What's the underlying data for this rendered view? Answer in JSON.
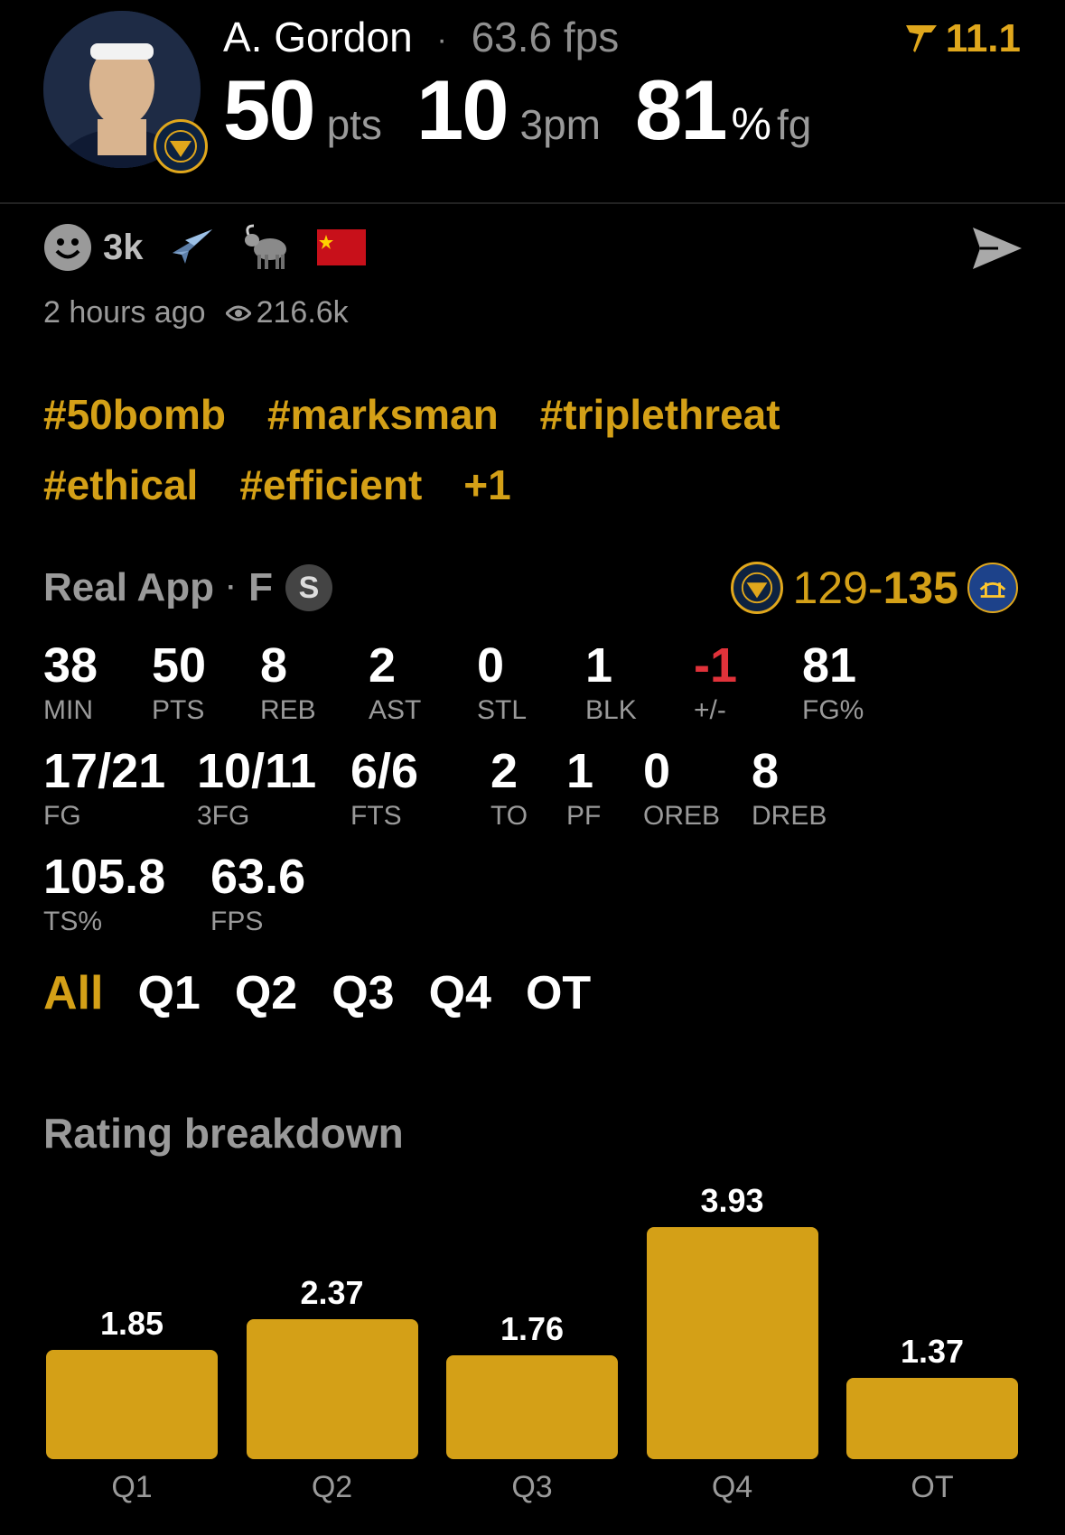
{
  "header": {
    "player_name": "A. Gordon",
    "separator": "·",
    "fps_text": "63.6 fps",
    "headline": [
      {
        "value": "50",
        "unit": "pts"
      },
      {
        "value": "10",
        "unit": "3pm"
      },
      {
        "value": "81",
        "unit": "%",
        "unit2": "fg"
      }
    ],
    "badge_value": "11.1",
    "badge_icon": "real-logo-icon"
  },
  "social": {
    "reaction_icon": "smiley-icon",
    "reaction_count": "3k",
    "emojis": [
      "airplane-icon",
      "goat-icon",
      "china-flag-icon"
    ],
    "share_icon": "send-icon",
    "time_ago": "2 hours ago",
    "views": "216.6k"
  },
  "hashtags": {
    "line1": [
      "#50bomb",
      "#marksman",
      "#triplethreat"
    ],
    "line2": [
      "#ethical",
      "#efficient",
      "+1"
    ]
  },
  "game": {
    "source": "Real App",
    "separator": "·",
    "position": "F",
    "starter_badge": "S",
    "score_home": "129",
    "score_dash": "-",
    "score_away": "135"
  },
  "stats": {
    "row1": [
      {
        "value": "38",
        "label": "MIN"
      },
      {
        "value": "50",
        "label": "PTS"
      },
      {
        "value": "8",
        "label": "REB"
      },
      {
        "value": "2",
        "label": "AST"
      },
      {
        "value": "0",
        "label": "STL"
      },
      {
        "value": "1",
        "label": "BLK"
      },
      {
        "value": "-1",
        "label": "+/-"
      },
      {
        "value": "81",
        "label": "FG%"
      }
    ],
    "row2": [
      {
        "value": "17/21",
        "label": "FG"
      },
      {
        "value": "10/11",
        "label": "3FG"
      },
      {
        "value": "6/6",
        "label": "FTS"
      },
      {
        "value": "2",
        "label": "TO"
      },
      {
        "value": "1",
        "label": "PF"
      },
      {
        "value": "0",
        "label": "OREB"
      },
      {
        "value": "8",
        "label": "DREB"
      }
    ],
    "row3": [
      {
        "value": "105.8",
        "label": "TS%"
      },
      {
        "value": "63.6",
        "label": "FPS"
      }
    ]
  },
  "period_tabs": [
    "All",
    "Q1",
    "Q2",
    "Q3",
    "Q4",
    "OT"
  ],
  "active_tab": "All",
  "rating": {
    "title": "Rating breakdown"
  },
  "chart_data": {
    "type": "bar",
    "title": "Rating breakdown",
    "categories": [
      "Q1",
      "Q2",
      "Q3",
      "Q4",
      "OT"
    ],
    "values": [
      1.85,
      2.37,
      1.76,
      3.93,
      1.37
    ],
    "value_labels": [
      "1.85",
      "2.37",
      "1.76",
      "3.93",
      "1.37"
    ],
    "color": "#d4a017"
  },
  "colors": {
    "accent": "#d4a017",
    "negative": "#e0323a",
    "background": "#000000"
  }
}
